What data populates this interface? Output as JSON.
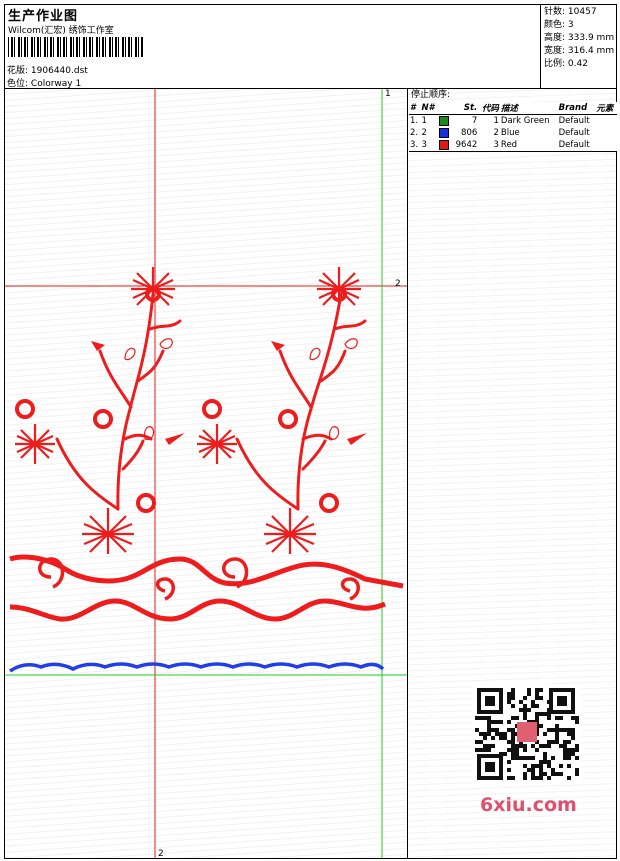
{
  "header": {
    "title": "生产作业图",
    "studio": "Wilcom(汇宏) 绣饰工作室",
    "file_label": "花版:",
    "file_name": "1906440.dst",
    "colorway_label": "色位:",
    "colorway_name": "Colorway 1"
  },
  "stats": {
    "stitches_label": "针数:",
    "stitches": "10457",
    "colors_label": "颜色:",
    "colors": "3",
    "height_label": "高度:",
    "height": "333.9 mm",
    "width_label": "宽度:",
    "width": "316.4 mm",
    "scale_label": "比例:",
    "scale": "0.42"
  },
  "guides": {
    "vertical_top": "1",
    "horizontal_right": "2",
    "vertical_bottom": "2"
  },
  "stop_sequence": {
    "title": "停止顺序:",
    "columns": [
      "#",
      "N#",
      "St.",
      "代码",
      "描述",
      "Brand",
      "元素"
    ],
    "rows": [
      {
        "index": "1.",
        "n": "1",
        "stitches": "7",
        "code": "1",
        "desc": "Dark Green",
        "brand": "Default",
        "color": "#1a8a1a"
      },
      {
        "index": "2.",
        "n": "2",
        "stitches": "806",
        "code": "2",
        "desc": "Blue",
        "brand": "Default",
        "color": "#1530e0"
      },
      {
        "index": "3.",
        "n": "3",
        "stitches": "9642",
        "code": "3",
        "desc": "Red",
        "brand": "Default",
        "color": "#e01818"
      }
    ]
  },
  "watermark": {
    "brand": "6xiu.com"
  },
  "colors": {
    "thread_red": "#ee1c1c",
    "thread_blue": "#1f3fe8",
    "guide_green": "#22cc22",
    "guide_red": "#e81818"
  }
}
